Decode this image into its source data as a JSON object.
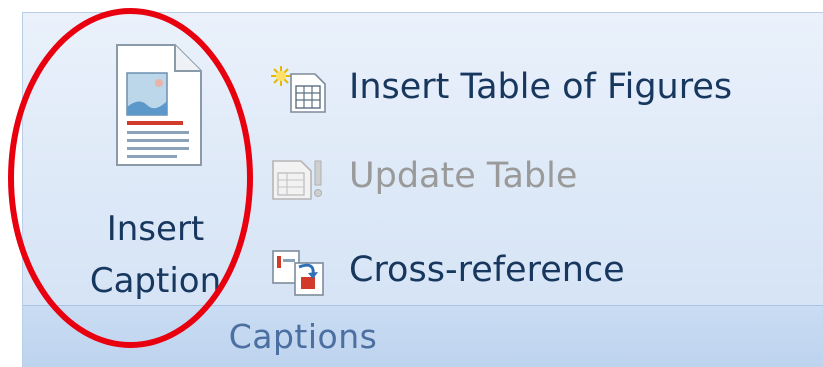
{
  "ribbon_group": {
    "name": "Captions",
    "insert_caption": {
      "line1": "Insert",
      "line2": "Caption",
      "icon": "caption-document-icon"
    },
    "commands": [
      {
        "label": "Insert Table of Figures",
        "icon": "table-of-figures-icon",
        "enabled": true
      },
      {
        "label": "Update Table",
        "icon": "update-table-icon",
        "enabled": false
      },
      {
        "label": "Cross-reference",
        "icon": "cross-reference-icon",
        "enabled": true
      }
    ]
  },
  "annotation": {
    "highlight_color": "#e8000f"
  },
  "colors": {
    "label_text": "#17375e",
    "disabled_text": "#9a9a9a",
    "group_background": "#dce8f7",
    "footer_background": "#c4d8f0"
  }
}
